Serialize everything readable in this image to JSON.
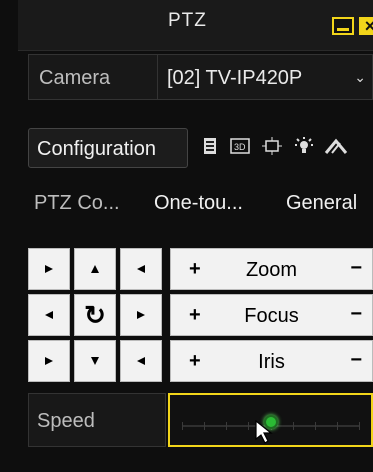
{
  "window": {
    "title": "PTZ",
    "minimize_icon": "minimize-icon",
    "close_icon": "close-icon"
  },
  "camera": {
    "label": "Camera",
    "value": "[02] TV-IP420P",
    "dropdown_icon": "chevron-down-icon"
  },
  "configuration": {
    "label": "Configuration",
    "tools": [
      "document-icon",
      "3d-icon",
      "target-frame-icon",
      "light-icon",
      "wiper-icon"
    ]
  },
  "tabs": [
    {
      "label": "PTZ Co..."
    },
    {
      "label": "One-tou..."
    },
    {
      "label": "General"
    }
  ],
  "controls": {
    "zoom": {
      "label": "Zoom",
      "plus": "+",
      "minus": "−"
    },
    "focus": {
      "label": "Focus",
      "plus": "+",
      "minus": "−"
    },
    "iris": {
      "label": "Iris",
      "plus": "+",
      "minus": "−"
    }
  },
  "speed": {
    "label": "Speed",
    "level": 0.5
  },
  "colors": {
    "accent": "#f2d51a",
    "knob": "#2bbb34",
    "background": "#0e0e0e"
  }
}
